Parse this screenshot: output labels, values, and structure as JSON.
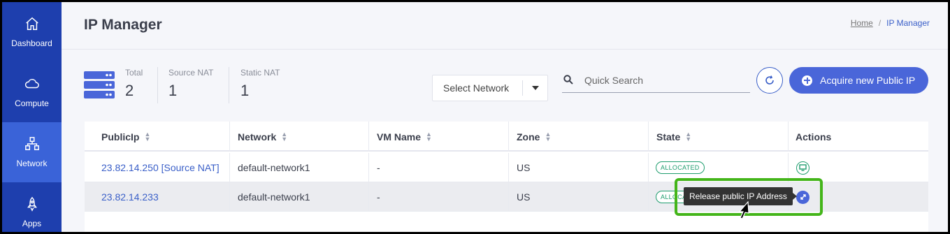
{
  "sidebar": {
    "items": [
      {
        "label": "Dashboard",
        "icon": "home-icon"
      },
      {
        "label": "Compute",
        "icon": "cloud-icon"
      },
      {
        "label": "Network",
        "icon": "network-icon",
        "active": true
      },
      {
        "label": "Apps",
        "icon": "rocket-icon"
      }
    ]
  },
  "header": {
    "title": "IP Manager",
    "breadcrumb": {
      "home": "Home",
      "separator": "/",
      "current": "IP Manager"
    }
  },
  "stats": [
    {
      "label": "Total",
      "value": "2"
    },
    {
      "label": "Source NAT",
      "value": "1"
    },
    {
      "label": "Static NAT",
      "value": "1"
    }
  ],
  "toolbar": {
    "select_network": "Select Network",
    "search_placeholder": "Quick Search",
    "acquire_label": "Acquire new Public IP"
  },
  "table": {
    "columns": [
      "PublicIp",
      "Network",
      "VM Name",
      "Zone",
      "State",
      "Actions"
    ],
    "rows": [
      {
        "public_ip": "23.82.14.250 [Source NAT]",
        "network": "default-network1",
        "vm_name": "-",
        "zone": "US",
        "state": "ALLOCATED"
      },
      {
        "public_ip": "23.82.14.233",
        "network": "default-network1",
        "vm_name": "-",
        "zone": "US",
        "state": "ALLOCATED"
      }
    ]
  },
  "tooltip": {
    "text": "Release public IP Address"
  },
  "colors": {
    "sidebar": "#1e3fae",
    "sidebar_active": "#3a63d8",
    "primary": "#4a66d9",
    "success": "#1f9d6e",
    "highlight": "#44b51a"
  }
}
